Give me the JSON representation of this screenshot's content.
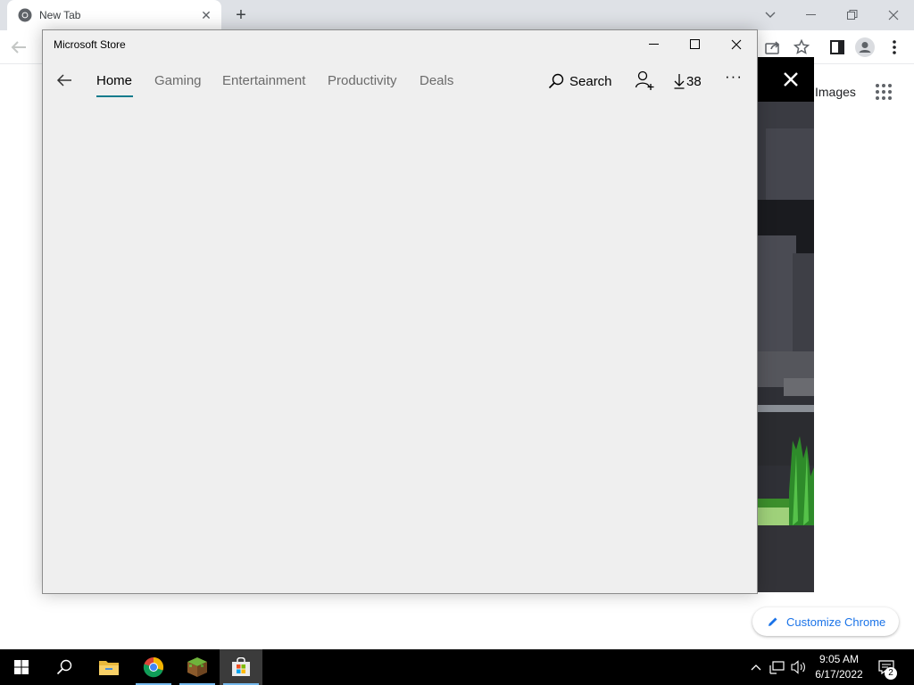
{
  "chrome": {
    "tab_title": "New Tab",
    "customize_label": "Customize Chrome",
    "images_link": "Images"
  },
  "store": {
    "window_title": "Microsoft Store",
    "nav": [
      {
        "label": "Home",
        "active": true
      },
      {
        "label": "Gaming"
      },
      {
        "label": "Entertainment"
      },
      {
        "label": "Productivity"
      },
      {
        "label": "Deals"
      }
    ],
    "search_label": "Search",
    "download_count": "38",
    "more_label": "···",
    "accent_color": "#0f7b8c"
  },
  "taskbar": {
    "apps": [
      "start-icon",
      "search-icon",
      "file-explorer-icon",
      "chrome-icon",
      "minecraft-icon",
      "microsoft-store-icon"
    ],
    "time": "9:05 AM",
    "date": "6/17/2022",
    "notification_count": "2"
  }
}
